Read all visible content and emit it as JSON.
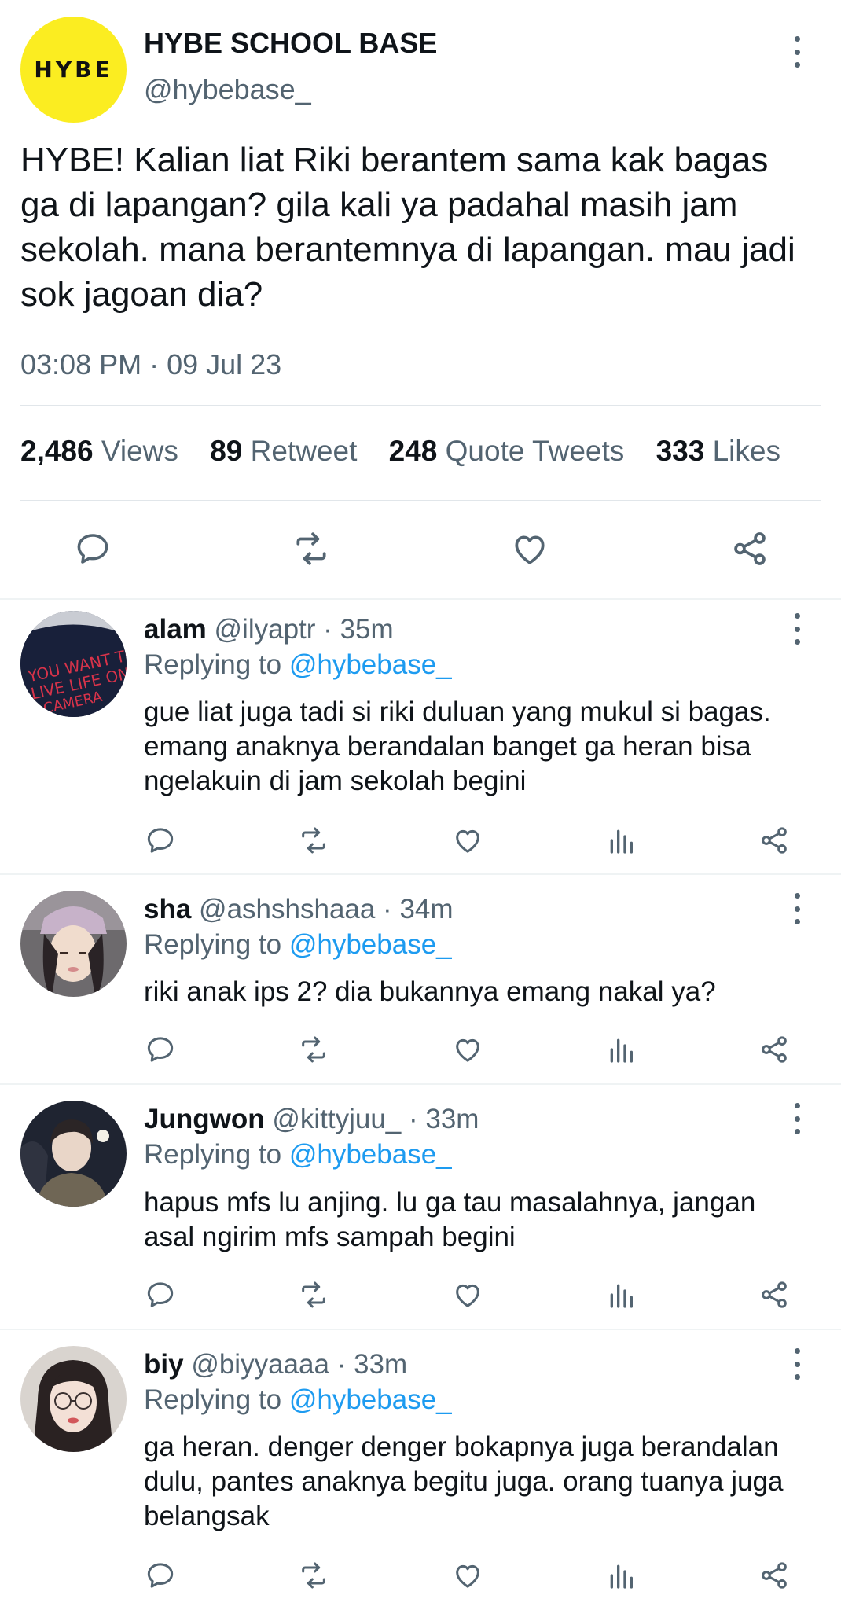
{
  "main_tweet": {
    "avatar_text": "HYBE",
    "display_name": "HYBE SCHOOL BASE",
    "handle": "@hybebase_",
    "text": "HYBE! Kalian liat Riki berantem sama kak bagas ga di lapangan? gila kali ya padahal masih jam sekolah. mana berantemnya di lapangan. mau jadi sok jagoan dia?",
    "timestamp": "03:08 PM · 09 Jul 23",
    "stats": {
      "views_count": "2,486",
      "views_label": "Views",
      "retweets_count": "89",
      "retweets_label": "Retweet",
      "quotes_count": "248",
      "quotes_label": "Quote Tweets",
      "likes_count": "333",
      "likes_label": "Likes"
    }
  },
  "replies": [
    {
      "name": "alam",
      "meta": "@ilyaptr · 35m",
      "replying_prefix": "Replying to",
      "replying_to": "@hybebase_",
      "text": "gue liat juga tadi si riki duluan yang mukul si bagas. emang anaknya berandalan banget ga heran bisa ngelakuin di jam sekolah begini"
    },
    {
      "name": "sha",
      "meta": "@ashshshaaa · 34m",
      "replying_prefix": "Replying to",
      "replying_to": "@hybebase_",
      "text": "riki anak ips 2? dia bukannya emang nakal ya?"
    },
    {
      "name": "Jungwon",
      "meta": "@kittyjuu_ · 33m",
      "replying_prefix": "Replying to",
      "replying_to": "@hybebase_",
      "text": "hapus mfs lu anjing. lu ga tau masalahnya, jangan asal ngirim mfs sampah begini"
    },
    {
      "name": "biy",
      "meta": "@biyyaaaa · 33m",
      "replying_prefix": "Replying to",
      "replying_to": "@hybebase_",
      "text": "ga heran. denger denger bokapnya juga berandalan dulu, pantes anaknya begitu juga. orang tuanya juga belangsak"
    }
  ],
  "icons": {
    "reply": "reply-icon",
    "retweet": "retweet-icon",
    "like": "heart-icon",
    "analytics": "analytics-icon",
    "share": "share-icon",
    "more": "more-vertical-icon"
  },
  "colors": {
    "accent": "#1d9bf0",
    "secondary_text": "#536471",
    "brand_yellow": "#fbed21"
  }
}
